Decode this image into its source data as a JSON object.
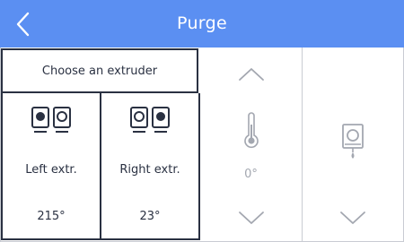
{
  "header": {
    "title": "Purge",
    "back_icon": "chevron-left-icon",
    "color": "#5b8ff2"
  },
  "extruder_panel": {
    "choose_label": "Choose an extruder",
    "left": {
      "label": "Left extr.",
      "temperature": "215°",
      "icon": "left-extruder-icon"
    },
    "right": {
      "label": "Right extr.",
      "temperature": "23°",
      "icon": "right-extruder-icon"
    }
  },
  "temperature_panel": {
    "value": "0°",
    "up_icon": "chevron-up-icon",
    "down_icon": "chevron-down-icon",
    "thermometer_icon": "thermometer-icon"
  },
  "purge_panel": {
    "icon": "purge-nozzle-icon",
    "down_icon": "chevron-down-icon"
  }
}
